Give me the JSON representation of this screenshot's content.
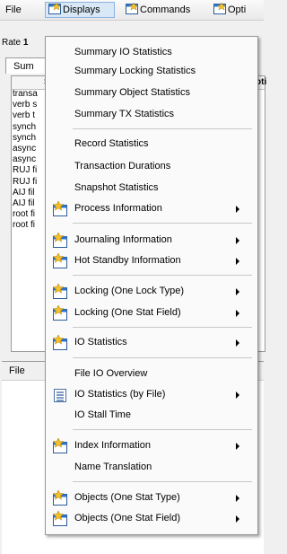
{
  "menubar": {
    "file": "File",
    "displays": "Displays",
    "commands": "Commands",
    "options": "Opti"
  },
  "background": {
    "rate_label": "Rate",
    "rate_value": "1",
    "right_char": "b",
    "tab_label": "Sum",
    "col_hdr": "S",
    "col_hdr_right": "oti",
    "rows": [
      "transa",
      "verb s",
      "verb t",
      "synch",
      "synch",
      "async",
      "async",
      "RUJ fi",
      "RUJ fi",
      "AIJ fil",
      "AIJ fil",
      "root fi",
      "root fi"
    ],
    "lower_file": "File"
  },
  "menu": {
    "items": [
      {
        "label": "Summary IO Statistics"
      },
      {
        "label": "Summary Locking Statistics"
      },
      {
        "label": "Summary Object Statistics"
      },
      {
        "label": "Summary TX Statistics"
      },
      {
        "label": "Record Statistics"
      },
      {
        "label": "Transaction Durations"
      },
      {
        "label": "Snapshot Statistics"
      },
      {
        "label": "Process Information"
      },
      {
        "label": "Journaling Information"
      },
      {
        "label": "Hot Standby Information"
      },
      {
        "label": "Locking (One Lock Type)"
      },
      {
        "label": "Locking (One Stat Field)"
      },
      {
        "label": "IO Statistics"
      },
      {
        "label": "File IO Overview"
      },
      {
        "label": "IO Statistics (by File)"
      },
      {
        "label": "IO Stall Time"
      },
      {
        "label": "Index Information"
      },
      {
        "label": "Name Translation"
      },
      {
        "label": "Objects (One Stat Type)"
      },
      {
        "label": "Objects (One Stat Field)"
      }
    ]
  }
}
